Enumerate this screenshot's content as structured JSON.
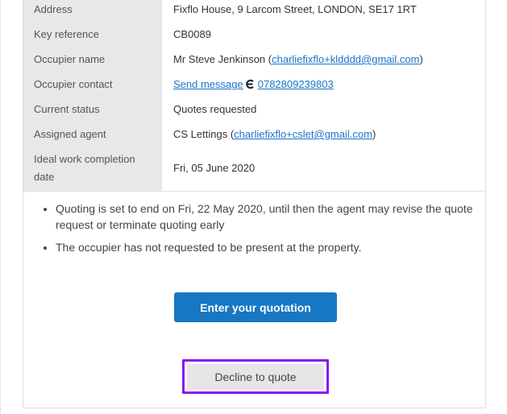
{
  "details": [
    {
      "label": "Address",
      "value": "Fixflo House, 9 Larcom Street, LONDON, SE17 1RT"
    },
    {
      "label": "Key reference",
      "value": "CB0089"
    },
    {
      "label": "Occupier name",
      "value_prefix": "Mr Steve Jenkinson (",
      "email": "charliefixflo+kldddd@gmail.com",
      "value_suffix": ")"
    },
    {
      "label": "Occupier contact",
      "send_message": "Send message",
      "phone": "0782809239803",
      "icon": "messaging-app-icon"
    },
    {
      "label": "Current status",
      "value": "Quotes requested"
    },
    {
      "label": "Assigned agent",
      "value_prefix": "CS Lettings (",
      "email": "charliefixflo+cslet@gmail.com",
      "value_suffix": ")"
    },
    {
      "label": "Ideal work completion date",
      "value": "Fri, 05 June 2020"
    }
  ],
  "notes": [
    "Quoting is set to end on Fri, 22 May 2020, until then the agent may revise the quote request or terminate quoting early",
    "The occupier has not requested to be present at the property."
  ],
  "buttons": {
    "enter_quotation": "Enter your quotation",
    "decline": "Decline to quote"
  },
  "colors": {
    "primary": "#1877c3",
    "highlight": "#8a12f0",
    "link": "#1a73c7"
  }
}
